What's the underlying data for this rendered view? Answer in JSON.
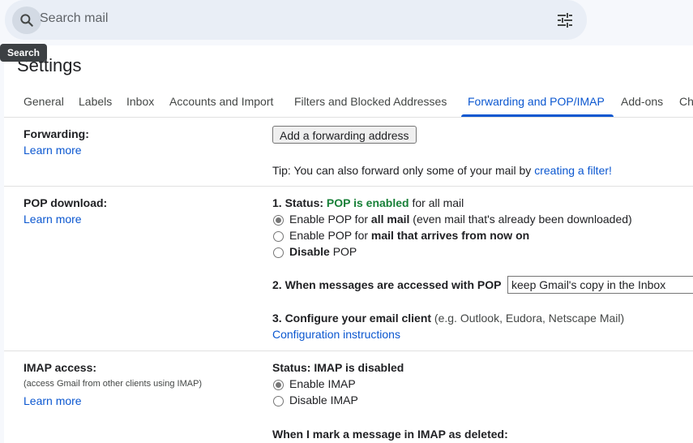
{
  "search": {
    "placeholder": "Search mail",
    "tooltip": "Search",
    "icons": [
      "search-icon",
      "tune-icon"
    ]
  },
  "page_title": "Settings",
  "tabs": [
    {
      "label": "General"
    },
    {
      "label": "Labels"
    },
    {
      "label": "Inbox"
    },
    {
      "label": "Accounts and Import"
    },
    {
      "label": "Filters and Blocked Addresses"
    },
    {
      "label": "Forwarding and POP/IMAP",
      "active": true
    },
    {
      "label": "Add-ons"
    },
    {
      "label": "Ch"
    }
  ],
  "colors": {
    "accent": "#0b57d0",
    "enabled_green": "#188038"
  },
  "forwarding": {
    "label": "Forwarding:",
    "learn_more": "Learn more",
    "add_button": "Add a forwarding address",
    "tip_prefix": "Tip: You can also forward only some of your mail by ",
    "tip_link": "creating a filter!"
  },
  "pop": {
    "label": "POP download:",
    "learn_more": "Learn more",
    "status_prefix": "1. Status: ",
    "status_value": "POP is enabled",
    "status_suffix": " for all mail",
    "options": [
      {
        "pre": "Enable POP for ",
        "bold": "all mail",
        "post": " (even mail that's already been downloaded)",
        "selected": true
      },
      {
        "pre": "Enable POP for ",
        "bold": "mail that arrives from now on",
        "post": "",
        "selected": false
      },
      {
        "pre": "",
        "bold": "Disable",
        "post": " POP",
        "selected": false
      }
    ],
    "when_accessed_label": "2. When messages are accessed with POP",
    "when_accessed_value": "keep Gmail's copy in the Inbox",
    "configure_label": "3. Configure your email client",
    "configure_hint": " (e.g. Outlook, Eudora, Netscape Mail)",
    "config_link": "Configuration instructions"
  },
  "imap": {
    "label": "IMAP access:",
    "sublabel": "(access Gmail from other clients using IMAP)",
    "learn_more": "Learn more",
    "status": "Status: IMAP is disabled",
    "options": [
      {
        "label": "Enable IMAP",
        "selected": true
      },
      {
        "label": "Disable IMAP",
        "selected": false
      }
    ],
    "cutoff_text": "When I mark a message in IMAP as deleted:"
  }
}
